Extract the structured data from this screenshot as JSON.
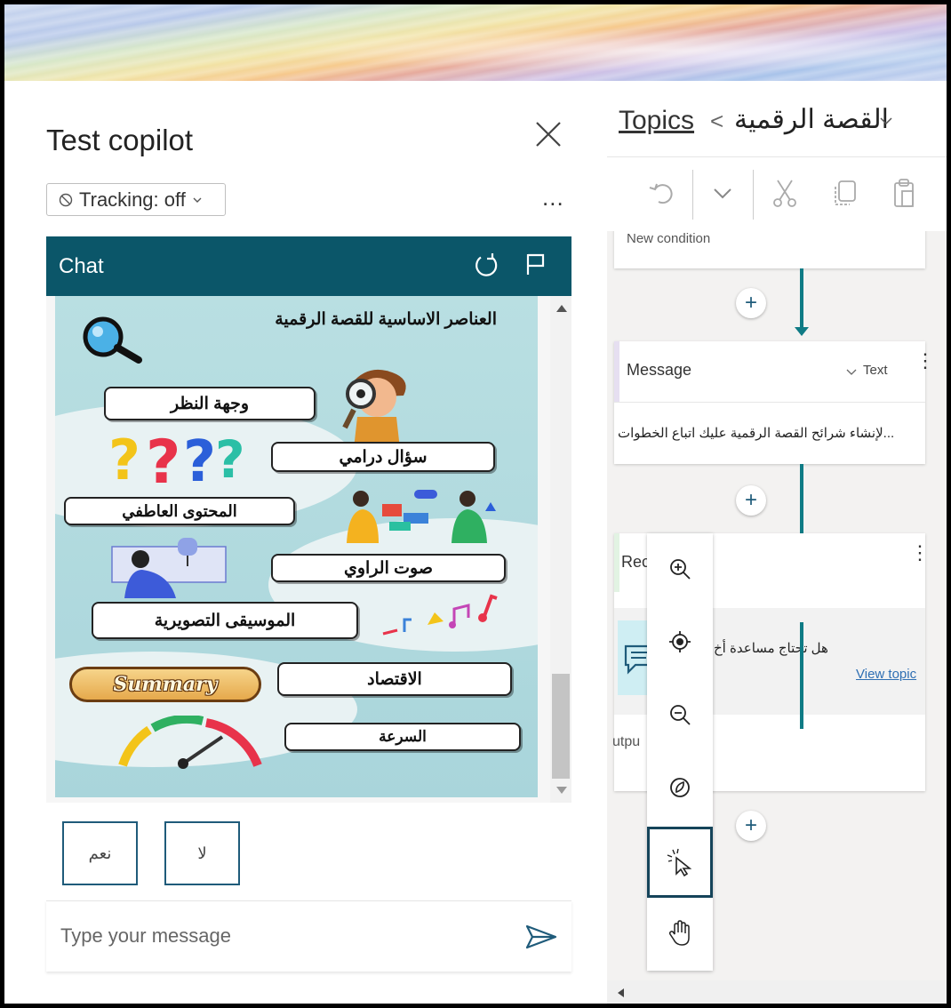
{
  "test_pane": {
    "title": "Test copilot",
    "tracking_label": "Tracking: off",
    "more_label": "...",
    "chat": {
      "title": "Chat",
      "infographic": {
        "title": "العناصر الاساسية للقصة الرقمية",
        "items": [
          "وجهة النظر",
          "سؤال درامي",
          "المحتوى العاطفي",
          "صوت الراوي",
          "الموسيقى التصويرية",
          "الاقتصاد",
          "السرعة"
        ],
        "summary_label": "Summary"
      },
      "quick_replies": [
        "لا",
        "نعم"
      ],
      "input_placeholder": "Type your message"
    }
  },
  "author_pane": {
    "breadcrumb": {
      "root": "Topics",
      "separator": "<",
      "current": "القصة الرقمية"
    },
    "partial_node_text": "New condition",
    "message_node": {
      "header": "Message",
      "type_label": "Text",
      "body": "...لإنشاء شرائح القصة الرقمية عليك اتباع الخطوات"
    },
    "question_node": {
      "header_partial": "Rec",
      "body": "هل تحتاج مساعدة أخ",
      "link": "View topic",
      "output_partial": "utpu"
    },
    "add_labels": [
      "+",
      "+",
      "+"
    ]
  },
  "colors": {
    "chat_header": "#0b5669",
    "connector": "#0f7b85",
    "accent_border": "#1f5b7a"
  },
  "icons": [
    "close-icon",
    "tracking-off-icon",
    "chevron-down-icon",
    "refresh-icon",
    "flag-icon",
    "send-icon",
    "undo-icon",
    "cut-icon",
    "copy-icon",
    "paste-icon",
    "zoom-in-icon",
    "recenter-icon",
    "zoom-out-icon",
    "minimap-icon",
    "select-pointer-icon",
    "pan-hand-icon",
    "search-magnifier-icon",
    "chat-bubble-icon"
  ]
}
